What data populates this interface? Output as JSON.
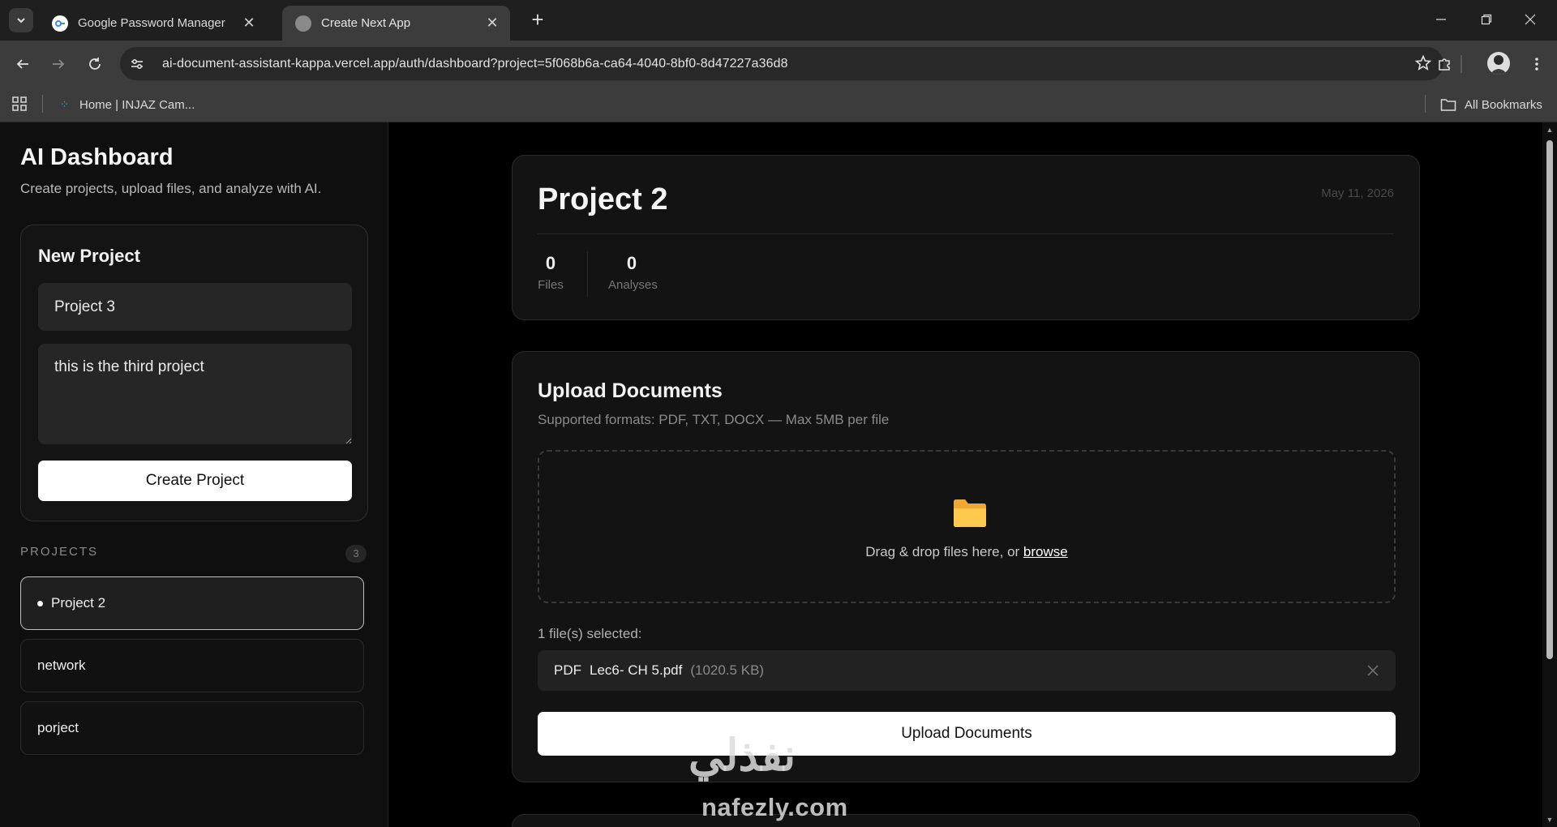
{
  "browser": {
    "tabs": [
      {
        "title": "Google Password Manager",
        "active": false,
        "favicon": "google-password-manager-icon"
      },
      {
        "title": "Create Next App",
        "active": true,
        "favicon": "globe-icon"
      }
    ],
    "url": "ai-document-assistant-kappa.vercel.app/auth/dashboard?project=5f068b6a-ca64-4040-8bf0-8d47227a36d8",
    "bookmarks": [
      {
        "label": "Home | INJAZ Cam...",
        "icon": "injaz-icon"
      }
    ],
    "all_bookmarks_label": "All Bookmarks"
  },
  "sidebar": {
    "title": "AI Dashboard",
    "subtitle": "Create projects, upload files, and analyze with AI.",
    "new_project": {
      "heading": "New Project",
      "name_value": "Project 3",
      "description_value": "this is the third project",
      "create_label": "Create Project"
    },
    "projects_label": "PROJECTS",
    "projects_count": "3",
    "projects": [
      {
        "name": "Project 2",
        "active": true
      },
      {
        "name": "network",
        "active": false
      },
      {
        "name": "porject",
        "active": false
      }
    ]
  },
  "project": {
    "title": "Project 2",
    "date": "May 11, 2026",
    "stats": [
      {
        "value": "0",
        "label": "Files"
      },
      {
        "value": "0",
        "label": "Analyses"
      }
    ]
  },
  "upload": {
    "title": "Upload Documents",
    "subtitle": "Supported formats: PDF, TXT, DOCX — Max 5MB per file",
    "drop_text": "Drag & drop files here, or ",
    "browse_label": "browse",
    "selected_label": "1 file(s) selected:",
    "files": [
      {
        "type": "PDF",
        "name": "Lec6- CH 5.pdf",
        "size": "(1020.5 KB)"
      }
    ],
    "button_label": "Upload Documents"
  },
  "watermark": {
    "arabic": "نفذلي",
    "latin": "nafezly.com"
  },
  "colors": {
    "page_bg": "#000000",
    "sidebar_bg": "#0f0f0f",
    "card_bg": "#131313",
    "primary_button": "#ffffff",
    "chrome": "#3c3c3c"
  }
}
